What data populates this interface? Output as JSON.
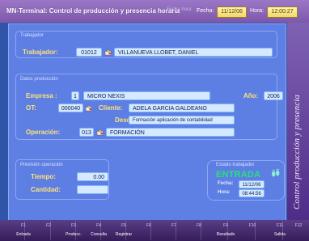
{
  "title_bar": {
    "title": "MN-Terminal: Control de producción y presencia horaria",
    "ghost_text": "Fecha hora",
    "date_label": "Fecha:",
    "date_value": "11/12/06",
    "time_label": "Hora:",
    "time_value": "12:00:27"
  },
  "side_label": "Control producción y presencia",
  "trabajador_section": {
    "title": "Trabajador",
    "worker_label": "Trabajador:",
    "worker_code": "01012",
    "worker_name": "VILLANUEVA LLOBET, DANIEL"
  },
  "datos_produccion": {
    "title": "Datos producción",
    "empresa_label": "Empresa :",
    "empresa_code": "1",
    "empresa_name": "MICRO NEXIS",
    "anio_label": "Año:",
    "anio_value": "2006",
    "ot_label": "OT:",
    "ot_value": "000040",
    "cliente_label": "Cliente:",
    "cliente_value": "ADELA GARCIA GALDEANO",
    "descrip_label": "Descrip.:",
    "descrip_value": "Formación aplicación de contabilidad",
    "operacion_label": "Operación:",
    "operacion_code": "013",
    "operacion_name": "FORMACIÓN"
  },
  "prevision_operacion": {
    "title": "Previsión operación",
    "tiempo_label": "Tiempo:",
    "tiempo_value": "0.00",
    "cantidad_label": "Cantidad:",
    "cantidad_value": ""
  },
  "estado_trabajador": {
    "title": "Estado trabajador",
    "status": "ENTRADA",
    "fecha_label": "Fecha:",
    "fecha_value": "11/12/06",
    "hora_label": "Hora:",
    "hora_value": "08:44:56"
  },
  "function_keys": [
    {
      "key": "F1",
      "desc": "Entrada"
    },
    {
      "key": "F2",
      "desc": ""
    },
    {
      "key": "F3",
      "desc": "Producc."
    },
    {
      "key": "F4",
      "desc": "Consulta"
    },
    {
      "key": "F5",
      "desc": "Registrar"
    },
    {
      "key": "F6",
      "desc": ""
    },
    {
      "key": "F7",
      "desc": ""
    },
    {
      "key": "F8",
      "desc": ""
    },
    {
      "key": "F9",
      "desc": "Resultado"
    },
    {
      "key": "F10",
      "desc": ""
    },
    {
      "key": "F11",
      "desc": "Salida"
    },
    {
      "key": "F12",
      "desc": ""
    }
  ],
  "colors": {
    "background": "#2e55a7",
    "panel": "#5e7fe3",
    "label": "#ffe37a",
    "field": "#d6e9ff",
    "title_bar": "#8d67ba",
    "status_text": "#24e37d"
  },
  "icons": {
    "lookup": "lookup-icon",
    "status": "footprints-icon"
  }
}
